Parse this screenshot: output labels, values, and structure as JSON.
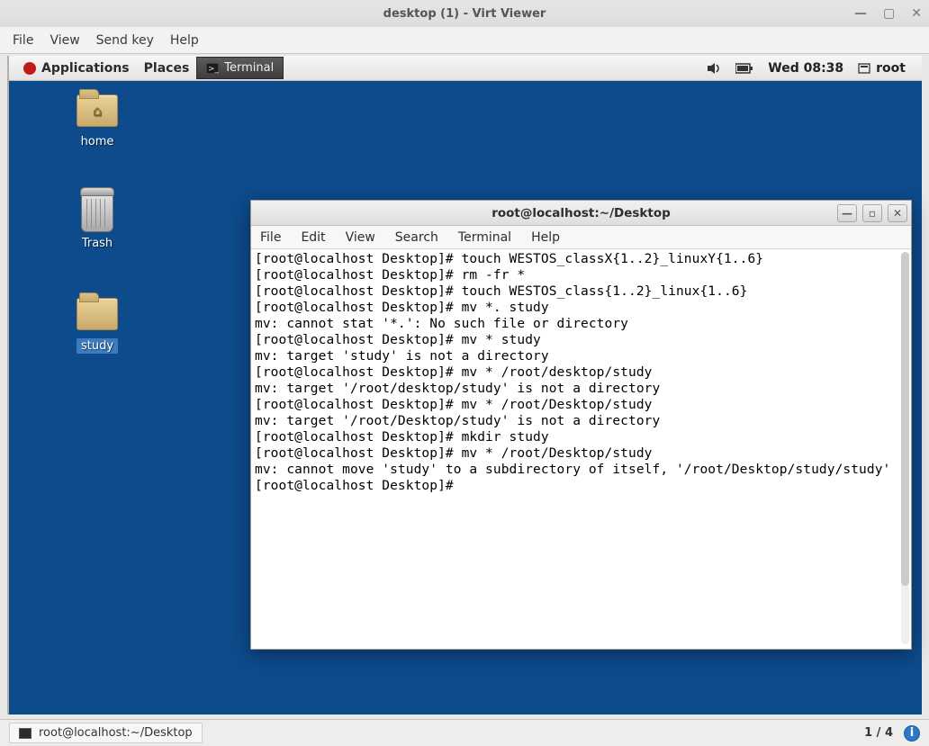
{
  "host": {
    "title": "desktop (1) - Virt Viewer",
    "menus": {
      "file": "File",
      "view": "View",
      "sendkey": "Send key",
      "help": "Help"
    },
    "taskbar": {
      "task_label": "root@localhost:~/Desktop",
      "pager": "1 / 4"
    }
  },
  "gnome": {
    "applications": "Applications",
    "places": "Places",
    "task_terminal": "Terminal",
    "clock": "Wed 08:38",
    "user": "root"
  },
  "desktop": {
    "home": "home",
    "trash": "Trash",
    "study": "study"
  },
  "terminal": {
    "title": "root@localhost:~/Desktop",
    "menus": {
      "file": "File",
      "edit": "Edit",
      "view": "View",
      "search": "Search",
      "terminal": "Terminal",
      "help": "Help"
    },
    "lines": [
      "[root@localhost Desktop]# touch WESTOS_classX{1..2}_linuxY{1..6}",
      "[root@localhost Desktop]# rm -fr *",
      "[root@localhost Desktop]# touch WESTOS_class{1..2}_linux{1..6}",
      "[root@localhost Desktop]# mv *. study",
      "mv: cannot stat '*.': No such file or directory",
      "[root@localhost Desktop]# mv * study",
      "mv: target 'study' is not a directory",
      "[root@localhost Desktop]# mv * /root/desktop/study",
      "mv: target '/root/desktop/study' is not a directory",
      "[root@localhost Desktop]# mv * /root/Desktop/study",
      "mv: target '/root/Desktop/study' is not a directory",
      "[root@localhost Desktop]# mkdir study",
      "[root@localhost Desktop]# mv * /root/Desktop/study",
      "mv: cannot move 'study' to a subdirectory of itself, '/root/Desktop/study/study'",
      "[root@localhost Desktop]# "
    ]
  }
}
